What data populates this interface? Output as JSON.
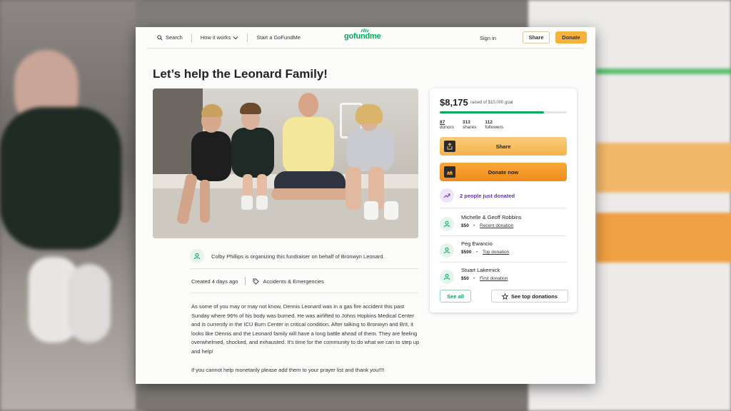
{
  "nav": {
    "search_label": "Search",
    "how_it_works_label": "How it works",
    "start_label": "Start a GoFundMe",
    "logo_text": "gofundme",
    "signin_label": "Sign in",
    "share_label": "Share",
    "donate_label": "Donate"
  },
  "campaign": {
    "title": "Let’s help the Leonard Family!",
    "organizer_text": "Colby Phillips is organizing this fundraiser on behalf of Bronwyn Leonard.",
    "created_text": "Created 4 days ago",
    "category": "Accidents & Emergencies",
    "story": [
      "As some of you may or may not know, Dennis Leonard was in a gas fire accident this past Sunday where 96% of his body was burned. He was airlifted to Johns Hopkins Medical Center and is currently in the ICU Burn Center in critical condition. After talking to Bronwyn and Brit, it looks like Dennis and the Leonard family will have a long battle ahead of them. They are feeling overwhelmed, shocked, and exhausted. It’s time for the community to do what we can to step up and help!",
      "If you cannot help monetarily please add them to your prayer list and thank you!!!!"
    ]
  },
  "panel": {
    "amount": "$8,175",
    "raised_text": "raised of $10,000 goal",
    "progress_fraction": 0.8175,
    "stats": [
      {
        "num": "87",
        "label": "donors"
      },
      {
        "num": "313",
        "label": "shares"
      },
      {
        "num": "112",
        "label": "followers"
      }
    ],
    "share_label": "Share",
    "donate_label": "Donate now",
    "just_donated": "2 people just donated",
    "donors": [
      {
        "name": "Michelle & Geoff Robbins",
        "amount": "$50",
        "tag": "Recent donation"
      },
      {
        "name": "Peg Ewancio",
        "amount": "$500",
        "tag": "Top donation"
      },
      {
        "name": "Stuart Lakernick",
        "amount": "$50",
        "tag": "First donation"
      }
    ],
    "see_all_label": "See all",
    "see_top_label": "See top donations"
  },
  "colors": {
    "brand_green": "#02a95c",
    "donate_orange": "#f5b13d",
    "purple": "#6b2fb3"
  }
}
